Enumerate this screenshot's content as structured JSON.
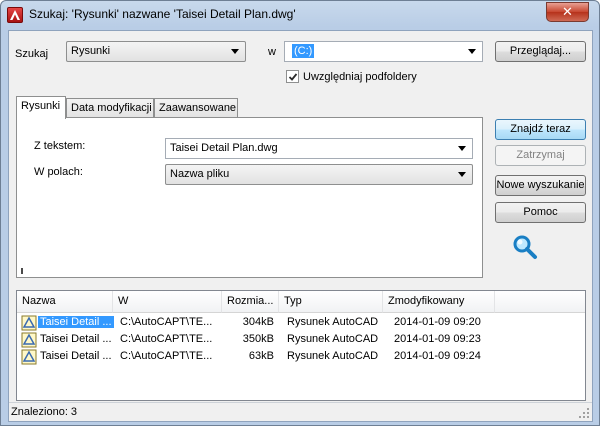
{
  "window": {
    "title": "Szukaj: 'Rysunki' nazwane 'Taisei Detail Plan.dwg'",
    "close_glyph": "✕"
  },
  "search": {
    "szukaj_label": "Szukaj",
    "szukaj_value": "Rysunki",
    "w_label": "w",
    "w_value": "(C:)",
    "browse_button": "Przeglądaj...",
    "subfolders_label": "Uwzględniaj podfoldery",
    "subfolders_checked": true
  },
  "tabs": [
    {
      "label": "Rysunki",
      "active": true
    },
    {
      "label": "Data modyfikacji",
      "active": false
    },
    {
      "label": "Zaawansowane",
      "active": false
    }
  ],
  "tab_rysunki": {
    "text_label": "Z tekstem:",
    "text_value": "Taisei Detail Plan.dwg",
    "fields_label": "W polach:",
    "fields_value": "Nazwa pliku"
  },
  "actions": {
    "find_now": "Znajdź teraz",
    "stop": "Zatrzymaj",
    "new_search": "Nowe wyszukanie",
    "help": "Pomoc",
    "search_icon": "magnifier-icon"
  },
  "results": {
    "columns": [
      "Nazwa",
      "W",
      "Rozmia...",
      "Typ",
      "Zmodyfikowany"
    ],
    "rows": [
      {
        "name": "Taisei Detail ...",
        "folder": "C:\\AutoCAPT\\TE...",
        "size": "304kB",
        "type": "Rysunek AutoCAD",
        "modified": "2014-01-09 09:20",
        "selected": true
      },
      {
        "name": "Taisei Detail ...",
        "folder": "C:\\AutoCAPT\\TE...",
        "size": "350kB",
        "type": "Rysunek AutoCAD",
        "modified": "2014-01-09 09:23",
        "selected": false
      },
      {
        "name": "Taisei Detail ...",
        "folder": "C:\\AutoCAPT\\TE...",
        "size": "63kB",
        "type": "Rysunek AutoCAD",
        "modified": "2014-01-09 09:24",
        "selected": false
      }
    ]
  },
  "status": {
    "text": "Znaleziono: 3"
  },
  "colors": {
    "selection": "#3399ff",
    "title_bar": "#b9cde6",
    "close_button": "#c7462f"
  }
}
